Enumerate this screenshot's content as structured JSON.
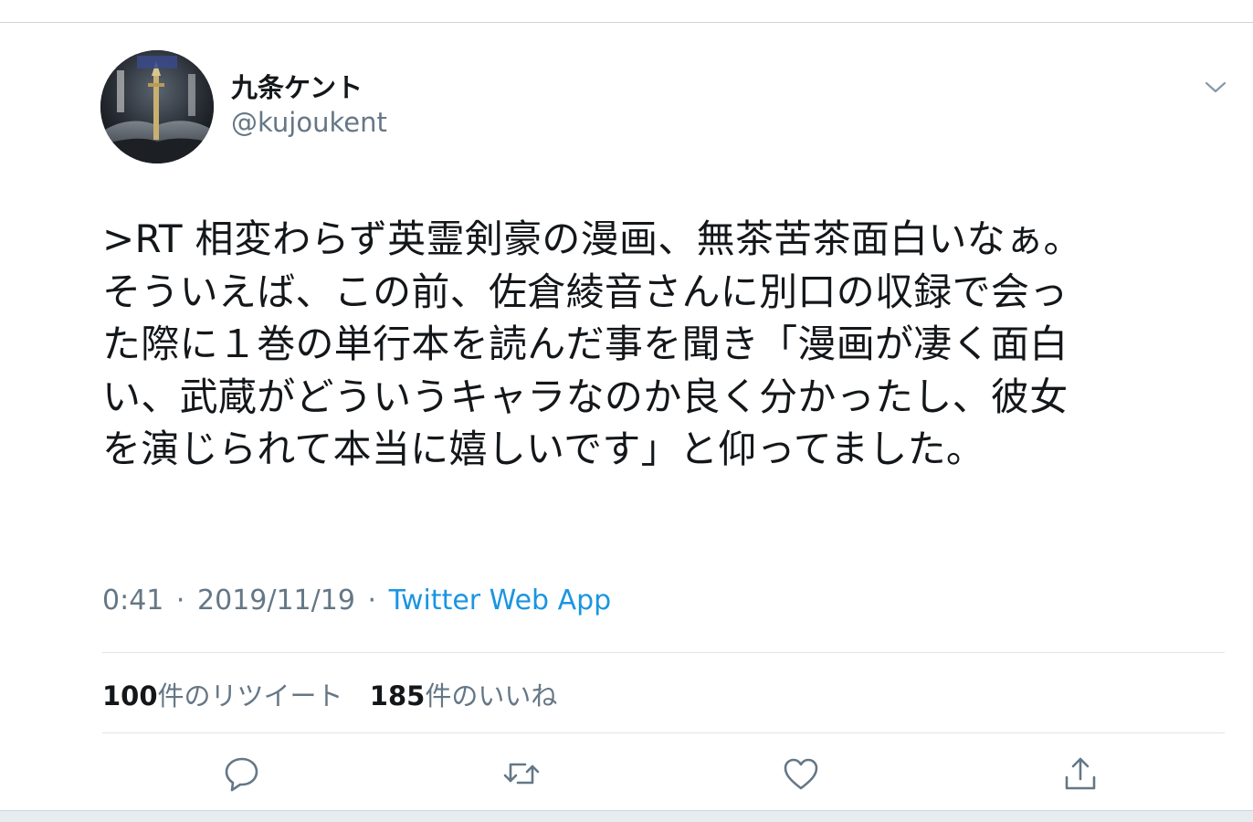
{
  "tweet": {
    "author": {
      "display_name": "九条ケント",
      "handle": "@kujoukent",
      "avatar_icon": "avatar-image"
    },
    "text_lines": [
      ">RT 相変わらず英霊剣豪の漫画、無茶苦茶面白いなぁ。",
      "そういえば、この前、佐倉綾音さんに別口の収録で会っ",
      "た際に１巻の単行本を読んだ事を聞き「漫画が凄く面白",
      "い、武蔵がどういうキャラなのか良く分かったし、彼女",
      "を演じられて本当に嬉しいです」と仰ってました。"
    ],
    "time": "0:41",
    "date": "2019/11/19",
    "separator": "·",
    "source": "Twitter Web App",
    "retweets": {
      "count": "100",
      "label": "件のリツイート"
    },
    "likes": {
      "count": "185",
      "label": "件のいいね"
    }
  },
  "actions": {
    "reply_icon": "reply-icon",
    "retweet_icon": "retweet-icon",
    "like_icon": "heart-icon",
    "share_icon": "share-icon",
    "menu_icon": "chevron-down-icon"
  },
  "colors": {
    "text_primary": "#14171a",
    "text_secondary": "#657786",
    "link": "#1b95e0",
    "divider": "#dfe3e7"
  }
}
